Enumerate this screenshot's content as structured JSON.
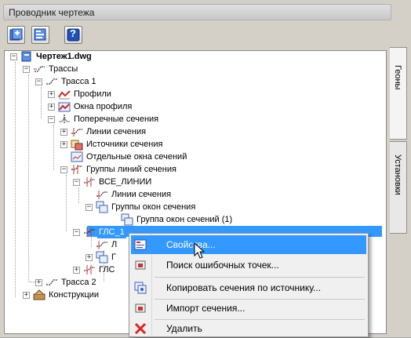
{
  "window": {
    "title": "Проводник чертежа"
  },
  "toolbar": {
    "buttons": [
      "new-drawing-icon",
      "drawing-settings-icon",
      "help-icon"
    ],
    "help_glyph": "?"
  },
  "tabs": [
    {
      "label": "Геоны"
    },
    {
      "label": "Установки"
    }
  ],
  "tree": {
    "nodes": [
      {
        "label": "Чертеж1.dwg",
        "expanded": true
      },
      {
        "label": "Трассы",
        "expanded": true
      },
      {
        "label": "Трасса 1",
        "expanded": true
      },
      {
        "label": "Профили",
        "expanded": false
      },
      {
        "label": "Окна профиля",
        "expanded": false
      },
      {
        "label": "Поперечные сечения",
        "expanded": true
      },
      {
        "label": "Линии сечения",
        "expanded": false
      },
      {
        "label": "Источники сечения",
        "expanded": false
      },
      {
        "label": "Отдельные окна сечений"
      },
      {
        "label": "Группы линий сечения",
        "expanded": true
      },
      {
        "label": "ВСЕ_ЛИНИИ",
        "expanded": true
      },
      {
        "label": "Линии сечения"
      },
      {
        "label": "Группы окон сечения",
        "expanded": true
      },
      {
        "label": "Группа окон сечений (1)"
      },
      {
        "label": "ГЛС_1",
        "expanded": true,
        "selected": true
      },
      {
        "label": "Л"
      },
      {
        "label": "Г",
        "expanded": false
      },
      {
        "label": "ГЛС",
        "expanded": false
      },
      {
        "label": "Трасса 2",
        "expanded": false
      },
      {
        "label": "Конструкции",
        "expanded": false
      }
    ],
    "expand_glyph": "+",
    "collapse_glyph": "−"
  },
  "context_menu": {
    "items": [
      {
        "label": "Свойства...",
        "highlighted": true,
        "icon": "properties-icon"
      },
      {
        "label": "Поиск ошибочных точек...",
        "icon": "find-errors-icon"
      },
      {
        "label": "Копировать сечения по источнику...",
        "icon": "copy-sections-icon"
      },
      {
        "label": "Импорт сечения...",
        "icon": "import-section-icon"
      },
      {
        "label": "Удалить",
        "icon": "delete-icon"
      }
    ]
  },
  "colors": {
    "selection": "#3399ff",
    "panel": "#d4d0c8",
    "delete": "#e02020"
  }
}
